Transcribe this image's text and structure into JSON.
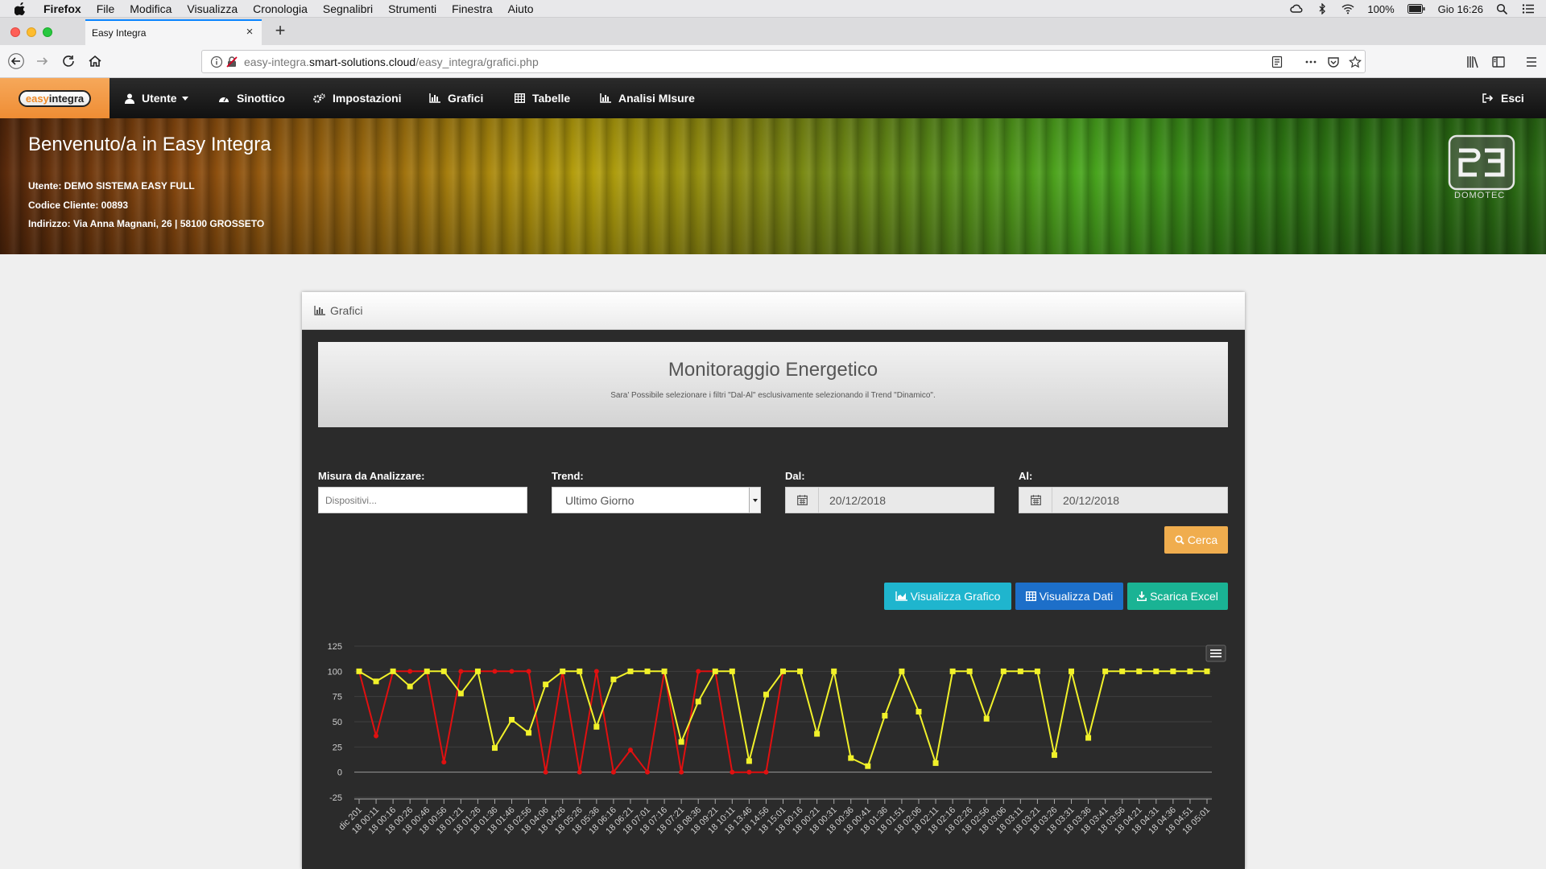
{
  "macos": {
    "menu": [
      "Firefox",
      "File",
      "Modifica",
      "Visualizza",
      "Cronologia",
      "Segnalibri",
      "Strumenti",
      "Finestra",
      "Aiuto"
    ],
    "battery": "100%",
    "clock": "Gio 16:26"
  },
  "browser": {
    "tab_title": "Easy Integra",
    "url_dim_prefix": "easy-integra.",
    "url_host": "smart-solutions.cloud",
    "url_path": "/easy_integra/grafici.php"
  },
  "app_nav": {
    "brand_easy": "easy",
    "brand_integra": "integra",
    "items": [
      {
        "label": "Utente",
        "icon": "user-icon"
      },
      {
        "label": "Sinottico",
        "icon": "dashboard-icon"
      },
      {
        "label": "Impostazioni",
        "icon": "cogs-icon"
      },
      {
        "label": "Grafici",
        "icon": "bar-chart-icon"
      },
      {
        "label": "Tabelle",
        "icon": "table-icon"
      },
      {
        "label": "Analisi MIsure",
        "icon": "bar-chart-icon"
      }
    ],
    "logout": "Esci"
  },
  "hero": {
    "title": "Benvenuto/a in Easy Integra",
    "utente": "Utente: DEMO SISTEMA EASY FULL",
    "codice": "Codice Cliente: 00893",
    "indirizzo": "Indirizzo: Via Anna Magnani, 26 | 58100 GROSSETO",
    "logo_text": "DOMOTEC"
  },
  "panel": {
    "heading": "Grafici",
    "jumbo_title": "Monitoraggio Energetico",
    "jumbo_sub": "Sara' Possibile selezionare i filtri \"Dal-Al\" esclusivamente selezionando il Trend \"Dinamico\".",
    "form": {
      "misura_label": "Misura da Analizzare:",
      "misura_placeholder": "Dispositivi...",
      "trend_label": "Trend:",
      "trend_value": "Ultimo Giorno",
      "dal_label": "Dal:",
      "dal_value": "20/12/2018",
      "al_label": "Al:",
      "al_value": "20/12/2018",
      "search_button": "Cerca"
    },
    "buttons": {
      "grafico": "Visualizza Grafico",
      "dati": "Visualizza Dati",
      "excel": "Scarica Excel"
    }
  },
  "colors": {
    "series_red": "#e01010",
    "series_yellow": "#f1f12a",
    "btn_cerca": "#f0ad4e",
    "btn_grafico": "#1fb5ce",
    "btn_dati": "#1d6fc9",
    "btn_excel": "#1ab394"
  },
  "chart_data": {
    "type": "line",
    "ylim": [
      -25,
      125
    ],
    "yticks": [
      125,
      100,
      75,
      50,
      25,
      0,
      -25
    ],
    "x": [
      "dic 201",
      "18 00:11",
      "18 00:16",
      "18 00:26",
      "18 00:46",
      "18 00:56",
      "18 01:21",
      "18 01:26",
      "18 01:36",
      "18 01:46",
      "18 02:56",
      "18 04:06",
      "18 04:26",
      "18 05:26",
      "18 05:36",
      "18 06:16",
      "18 06:21",
      "18 07:01",
      "18 07:16",
      "18 07:21",
      "18 08:36",
      "18 09:21",
      "18 10:11",
      "18 13:46",
      "18 14:56",
      "18 15:01",
      "18 00:16",
      "18 00:21",
      "18 00:31",
      "18 00:36",
      "18 00:41",
      "18 01:36",
      "18 01:51",
      "18 02:06",
      "18 02:11",
      "18 02:16",
      "18 02:26",
      "18 02:56",
      "18 03:06",
      "18 03:11",
      "18 03:21",
      "18 03:26",
      "18 03:31",
      "18 03:36",
      "18 03:41",
      "18 03:56",
      "18 04:21",
      "18 04:31",
      "18 04:36",
      "18 04:51",
      "18 05:01"
    ],
    "series": [
      {
        "values": [
          100,
          36,
          100,
          100,
          100,
          10,
          100,
          100,
          100,
          100,
          100,
          0,
          100,
          0,
          100,
          0,
          22,
          0,
          100,
          0,
          100,
          100,
          0,
          0,
          0,
          100
        ]
      },
      {
        "values": [
          100,
          90,
          100,
          85,
          100,
          100,
          78,
          100,
          24,
          52,
          39,
          87,
          100,
          100,
          45,
          92,
          100,
          100,
          100,
          30,
          70,
          100,
          100,
          11,
          77,
          100,
          100,
          38,
          100,
          14,
          6,
          56,
          100,
          60,
          9,
          100,
          100,
          53,
          100,
          100,
          100,
          17,
          100,
          34,
          100,
          100,
          100,
          100,
          100,
          100,
          100
        ]
      }
    ]
  }
}
